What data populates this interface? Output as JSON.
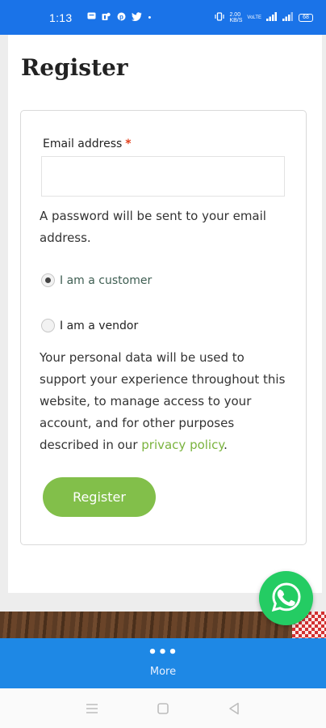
{
  "status_bar": {
    "time": "1:13",
    "left_icons": [
      "message-icon",
      "teams-icon",
      "pinterest-icon",
      "twitter-icon"
    ],
    "dot": "•",
    "network_speed": "2.00\nKB/S",
    "volte": "VoLTE",
    "battery": "68"
  },
  "page": {
    "title": "Register",
    "email_label": "Email address",
    "required_mark": "*",
    "email_value": "",
    "password_note": "A password will be sent to your email address.",
    "radios": [
      {
        "label": "I am a customer",
        "checked": true
      },
      {
        "label": "I am a vendor",
        "checked": false
      }
    ],
    "privacy_text_before": "Your personal data will be used to support your experience throughout this website, to manage access to your account, and for other purposes described in our ",
    "privacy_link": "privacy policy",
    "privacy_text_after": ".",
    "register_label": "Register"
  },
  "bottom_nav": {
    "dots": "•••",
    "more_label": "More"
  },
  "colors": {
    "status_bar": "#1a73e8",
    "accent_green": "#82bf4a",
    "whatsapp": "#24cc63",
    "bottom_bar": "#1e88e5"
  }
}
